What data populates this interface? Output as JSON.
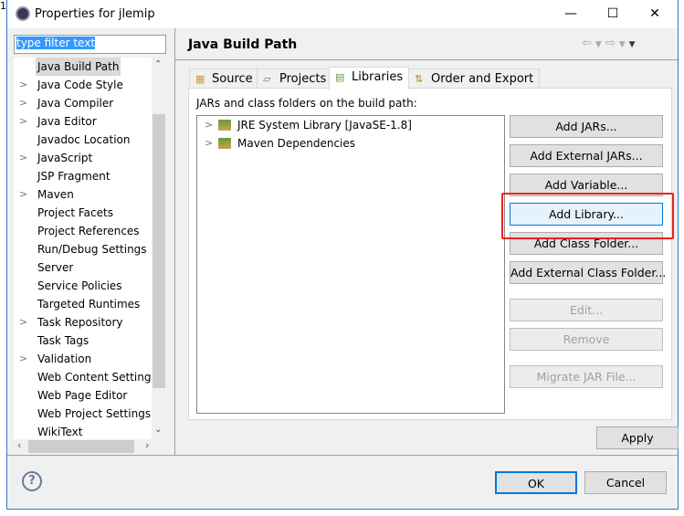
{
  "corner_text": "1",
  "window": {
    "title": "Properties for jlemip",
    "minimize": "—",
    "maximize": "☐",
    "close": "✕"
  },
  "filter": {
    "value": "type filter text"
  },
  "tree": [
    {
      "label": "Java Build Path",
      "expandable": false,
      "selected": true
    },
    {
      "label": "Java Code Style",
      "expandable": true
    },
    {
      "label": "Java Compiler",
      "expandable": true
    },
    {
      "label": "Java Editor",
      "expandable": true
    },
    {
      "label": "Javadoc Location",
      "expandable": false
    },
    {
      "label": "JavaScript",
      "expandable": true
    },
    {
      "label": "JSP Fragment",
      "expandable": false
    },
    {
      "label": "Maven",
      "expandable": true
    },
    {
      "label": "Project Facets",
      "expandable": false
    },
    {
      "label": "Project References",
      "expandable": false
    },
    {
      "label": "Run/Debug Settings",
      "expandable": false
    },
    {
      "label": "Server",
      "expandable": false
    },
    {
      "label": "Service Policies",
      "expandable": false
    },
    {
      "label": "Targeted Runtimes",
      "expandable": false
    },
    {
      "label": "Task Repository",
      "expandable": true
    },
    {
      "label": "Task Tags",
      "expandable": false
    },
    {
      "label": "Validation",
      "expandable": true
    },
    {
      "label": "Web Content Settings",
      "expandable": false
    },
    {
      "label": "Web Page Editor",
      "expandable": false
    },
    {
      "label": "Web Project Settings",
      "expandable": false
    },
    {
      "label": "WikiText",
      "expandable": false
    }
  ],
  "page": {
    "title": "Java Build Path",
    "tabs": [
      {
        "label": "Source",
        "icon": "source-folder-icon"
      },
      {
        "label": "Projects",
        "icon": "folder-icon"
      },
      {
        "label": "Libraries",
        "icon": "library-icon",
        "active": true
      },
      {
        "label": "Order and Export",
        "icon": "order-icon"
      }
    ],
    "panel_label": "JARs and class folders on the build path:",
    "libraries": [
      "JRE System Library [JavaSE-1.8]",
      "Maven Dependencies"
    ],
    "buttons": [
      {
        "label": "Add JARs...",
        "enabled": true
      },
      {
        "label": "Add External JARs...",
        "enabled": true
      },
      {
        "label": "Add Variable...",
        "enabled": true
      },
      {
        "label": "Add Library...",
        "enabled": true,
        "highlighted": true
      },
      {
        "label": "Add Class Folder...",
        "enabled": true
      },
      {
        "label": "Add External Class Folder...",
        "enabled": true
      },
      {
        "label": "Edit...",
        "enabled": false
      },
      {
        "label": "Remove",
        "enabled": false
      },
      {
        "label": "Migrate JAR File...",
        "enabled": false
      }
    ],
    "apply": "Apply"
  },
  "footer": {
    "ok": "OK",
    "cancel": "Cancel",
    "help": "?"
  },
  "colors": {
    "highlight": "#e8241c",
    "selection": "#3399ff",
    "focus": "#0078d7"
  }
}
